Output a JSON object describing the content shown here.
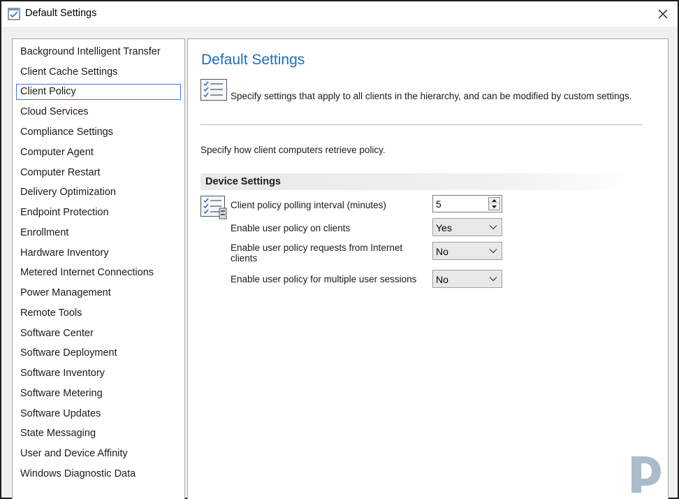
{
  "window": {
    "title": "Default Settings",
    "close_glyph": "✕"
  },
  "nav": {
    "items": [
      {
        "label": "Background Intelligent Transfer"
      },
      {
        "label": "Client Cache Settings"
      },
      {
        "label": "Client Policy"
      },
      {
        "label": "Cloud Services"
      },
      {
        "label": "Compliance Settings"
      },
      {
        "label": "Computer Agent"
      },
      {
        "label": "Computer Restart"
      },
      {
        "label": "Delivery Optimization"
      },
      {
        "label": "Endpoint Protection"
      },
      {
        "label": "Enrollment"
      },
      {
        "label": "Hardware Inventory"
      },
      {
        "label": "Metered Internet Connections"
      },
      {
        "label": "Power Management"
      },
      {
        "label": "Remote Tools"
      },
      {
        "label": "Software Center"
      },
      {
        "label": "Software Deployment"
      },
      {
        "label": "Software Inventory"
      },
      {
        "label": "Software Metering"
      },
      {
        "label": "Software Updates"
      },
      {
        "label": "State Messaging"
      },
      {
        "label": "User and Device Affinity"
      },
      {
        "label": "Windows Diagnostic Data"
      }
    ],
    "selected": "Client Policy"
  },
  "content": {
    "page_title": "Default Settings",
    "header_description": "Specify settings that apply to all clients in the hierarchy, and can be modified by custom settings.",
    "policy_description": "Specify how client computers retrieve policy.",
    "section_title": "Device Settings",
    "settings": [
      {
        "label": "Client policy polling interval (minutes)",
        "control": "spinner",
        "value": "5"
      },
      {
        "label": "Enable user policy on clients",
        "control": "dropdown",
        "value": "Yes"
      },
      {
        "label": "Enable user policy requests from Internet clients",
        "control": "dropdown",
        "value": "No"
      },
      {
        "label": "Enable user policy for multiple user sessions",
        "control": "dropdown",
        "value": "No"
      }
    ]
  },
  "colors": {
    "title_blue": "#1e6dbb",
    "selection_border": "#3c7ad8",
    "watermark": "#9bb0c2"
  },
  "icons": {
    "app": "checklist-window-icon",
    "header": "checklist-icon",
    "setting": "checklist-settings-icon",
    "watermark": "d-logo"
  }
}
